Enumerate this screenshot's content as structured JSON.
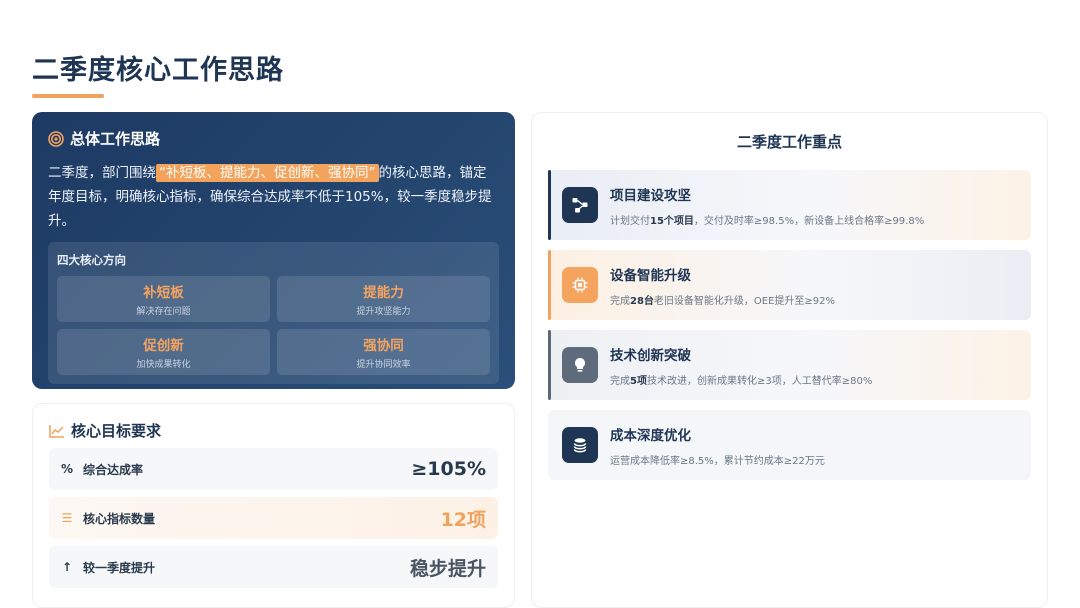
{
  "page": {
    "title": "二季度核心工作思路"
  },
  "overall": {
    "heading": "总体工作思路",
    "text_before": "二季度，部门围绕",
    "highlight": "“补短板、提能力、促创新、强协同”",
    "text_after": "的核心思路，锚定年度目标，明确核心指标，确保综合达成率不低于105%，较一季度稳步提升。",
    "directions_title": "四大核心方向",
    "directions": [
      {
        "name": "补短板",
        "desc": "解决存在问题"
      },
      {
        "name": "提能力",
        "desc": "提升攻坚能力"
      },
      {
        "name": "促创新",
        "desc": "加快成果转化"
      },
      {
        "name": "强协同",
        "desc": "提升协同效率"
      }
    ]
  },
  "goals": {
    "heading": "核心目标要求",
    "items": [
      {
        "icon": "percent-icon",
        "label": "综合达成率",
        "value": "≥105%"
      },
      {
        "icon": "list-icon",
        "label": "核心指标数量",
        "value": "12项"
      },
      {
        "icon": "arrow-up-icon",
        "label": "较一季度提升",
        "value": "稳步提升"
      }
    ]
  },
  "focus": {
    "title": "二季度工作重点",
    "items": [
      {
        "icon": "network-icon",
        "name": "项目建设攻坚",
        "desc_pre": "计划交付",
        "desc_bold": "15个项目",
        "desc_post": "，交付及时率≥98.5%，新设备上线合格率≥99.8%"
      },
      {
        "icon": "chip-icon",
        "name": "设备智能升级",
        "desc_pre": "完成",
        "desc_bold": "28台",
        "desc_post": "老旧设备智能化升级，OEE提升至≥92%"
      },
      {
        "icon": "lightbulb-icon",
        "name": "技术创新突破",
        "desc_pre": "完成",
        "desc_bold": "5项",
        "desc_post": "技术改进，创新成果转化≥3项，人工替代率≥80%"
      },
      {
        "icon": "coins-icon",
        "name": "成本深度优化",
        "desc_pre": "运营成本降低率≥8.5%，累计节约成本≥22万元",
        "desc_bold": "",
        "desc_post": ""
      }
    ]
  },
  "colors": {
    "navy": "#1e3553",
    "accent_orange": "#f0a35e",
    "highlight_orange": "#f3a35c"
  }
}
